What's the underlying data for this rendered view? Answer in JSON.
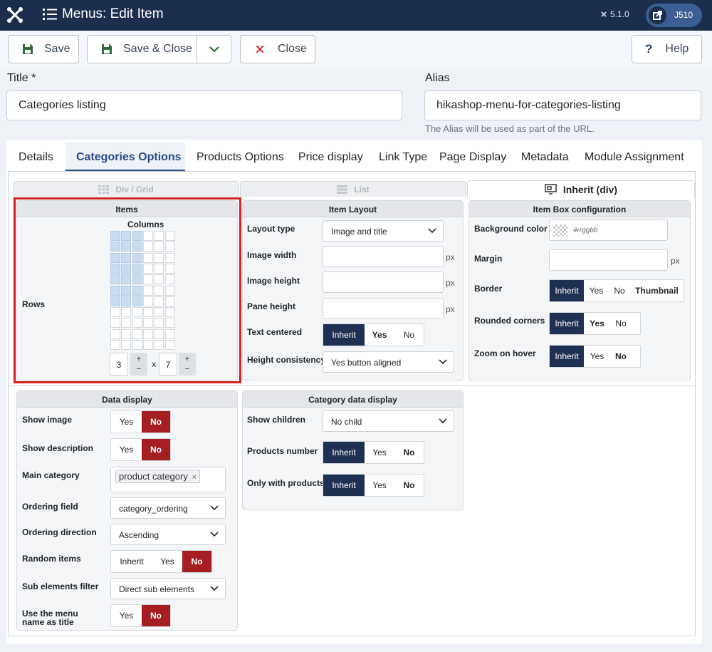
{
  "header": {
    "title": "Menus: Edit Item",
    "version": "5.1.0",
    "user_label": "J510",
    "icons": {
      "logo": "joomla-logo-icon",
      "menu": "list-icon",
      "version": "joomla-small-icon",
      "external": "external-link-icon"
    },
    "colors": {
      "bar": "#1b2f4d",
      "pill": "#3b5f94"
    }
  },
  "toolbar": {
    "save_label": "Save",
    "save_close_label": "Save & Close",
    "close_label": "Close",
    "help_label": "Help",
    "help_glyph": "?",
    "icons": {
      "save": "save-icon",
      "dropdown": "chevron-down-icon",
      "close": "close-icon",
      "help": "question-icon"
    }
  },
  "form": {
    "title_label": "Title *",
    "title_value": "Categories listing",
    "alias_label": "Alias",
    "alias_value": "hikashop-menu-for-categories-listing",
    "alias_hint": "The Alias will be used as part of the URL."
  },
  "tabs": [
    "Details",
    "Categories Options",
    "Products Options",
    "Price display",
    "Link Type",
    "Page Display",
    "Metadata",
    "Module Assignment"
  ],
  "active_tab": "Categories Options",
  "layout_tabs": [
    "Div / Grid",
    "List",
    "Inherit (div)"
  ],
  "active_layout_tab": "Inherit (div)",
  "items_panel": {
    "title": "Items",
    "columns_label": "Columns",
    "rows_label": "Rows",
    "columns": "3",
    "rows": "7",
    "times": "x",
    "plus": "+",
    "minus": "−",
    "grid": {
      "total_cols": 6,
      "total_rows": 11,
      "selected_cols": 3,
      "selected_rows": 7
    }
  },
  "item_layout": {
    "title": "Item Layout",
    "layout_type_label": "Layout type",
    "layout_type_value": "Image and title",
    "image_width_label": "Image width",
    "image_height_label": "Image height",
    "pane_height_label": "Pane height",
    "unit": "px",
    "text_centered_label": "Text centered",
    "text_centered_options": [
      "Inherit",
      "Yes",
      "No"
    ],
    "height_consistency_label": "Height consistency",
    "height_consistency_value": "Yes button aligned"
  },
  "item_box": {
    "title": "Item Box configuration",
    "bg_color_label": "Background color",
    "bg_color_placeholder": "#rrggbb",
    "margin_label": "Margin",
    "unit": "px",
    "border_label": "Border",
    "border_options": [
      "Inherit",
      "Yes",
      "No",
      "Thumbnail"
    ],
    "rounded_label": "Rounded corners",
    "rounded_options": [
      "Inherit",
      "Yes",
      "No"
    ],
    "zoom_label": "Zoom on hover",
    "zoom_options": [
      "Inherit",
      "Yes",
      "No"
    ]
  },
  "data_display": {
    "title": "Data display",
    "show_image_label": "Show image",
    "show_desc_label": "Show description",
    "yes_no": [
      "Yes",
      "No"
    ],
    "main_category_label": "Main category",
    "main_category_tag": "product category",
    "tag_remove": "×",
    "ordering_field_label": "Ordering field",
    "ordering_field_value": "category_ordering",
    "ordering_dir_label": "Ordering direction",
    "ordering_dir_value": "Ascending",
    "random_label": "Random items",
    "random_options": [
      "Inherit",
      "Yes",
      "No"
    ],
    "sub_filter_label": "Sub elements filter",
    "sub_filter_value": "Direct sub elements",
    "menu_name_label_1": "Use the menu",
    "menu_name_label_2": "name as title"
  },
  "category_data": {
    "title": "Category data display",
    "show_children_label": "Show children",
    "show_children_value": "No child",
    "products_number_label": "Products number",
    "products_number_options": [
      "Inherit",
      "Yes",
      "No"
    ],
    "only_with_products_label": "Only with products",
    "only_with_products_options": [
      "Inherit",
      "Yes",
      "No"
    ]
  },
  "colors": {
    "dark_active": "#1f3152",
    "red_active": "#a51e22",
    "highlight_frame": "#d42020",
    "grid_selected": "#cadcf0"
  }
}
